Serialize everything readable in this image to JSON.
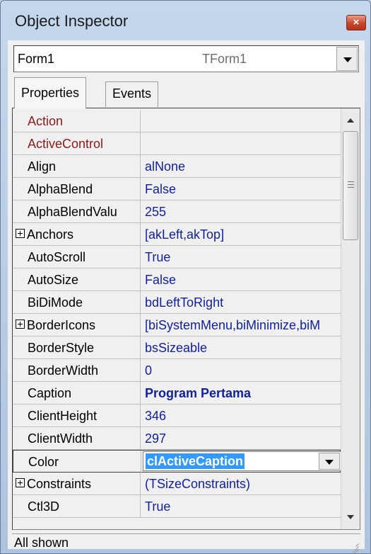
{
  "window": {
    "title": "Object Inspector",
    "close_glyph": "×"
  },
  "object_selector": {
    "name": "Form1",
    "class_name": "TForm1"
  },
  "tabs": [
    {
      "label": "Properties",
      "active": true
    },
    {
      "label": "Events",
      "active": false
    }
  ],
  "properties": [
    {
      "name": "Action",
      "value": "",
      "kind": "event"
    },
    {
      "name": "ActiveControl",
      "value": "",
      "kind": "event"
    },
    {
      "name": "Align",
      "value": "alNone"
    },
    {
      "name": "AlphaBlend",
      "value": "False"
    },
    {
      "name": "AlphaBlendValu",
      "value": "255"
    },
    {
      "name": "Anchors",
      "value": "[akLeft,akTop]",
      "expandable": true
    },
    {
      "name": "AutoScroll",
      "value": "True"
    },
    {
      "name": "AutoSize",
      "value": "False"
    },
    {
      "name": "BiDiMode",
      "value": "bdLeftToRight"
    },
    {
      "name": "BorderIcons",
      "value": "[biSystemMenu,biMinimize,biM",
      "expandable": true
    },
    {
      "name": "BorderStyle",
      "value": "bsSizeable"
    },
    {
      "name": "BorderWidth",
      "value": "0"
    },
    {
      "name": "Caption",
      "value": "Program Pertama",
      "bold": true
    },
    {
      "name": "ClientHeight",
      "value": "346"
    },
    {
      "name": "ClientWidth",
      "value": "297"
    },
    {
      "name": "Color",
      "value": "clActiveCaption",
      "selected": true
    },
    {
      "name": "Constraints",
      "value": "(TSizeConstraints)",
      "expandable": true
    },
    {
      "name": "Ctl3D",
      "value": "True"
    }
  ],
  "status": {
    "text": "All shown"
  },
  "colors": {
    "value_text": "#0f1fa0",
    "event_name": "#8b1a1a",
    "selection": "#3399ff",
    "close_button": "#c8442c"
  }
}
